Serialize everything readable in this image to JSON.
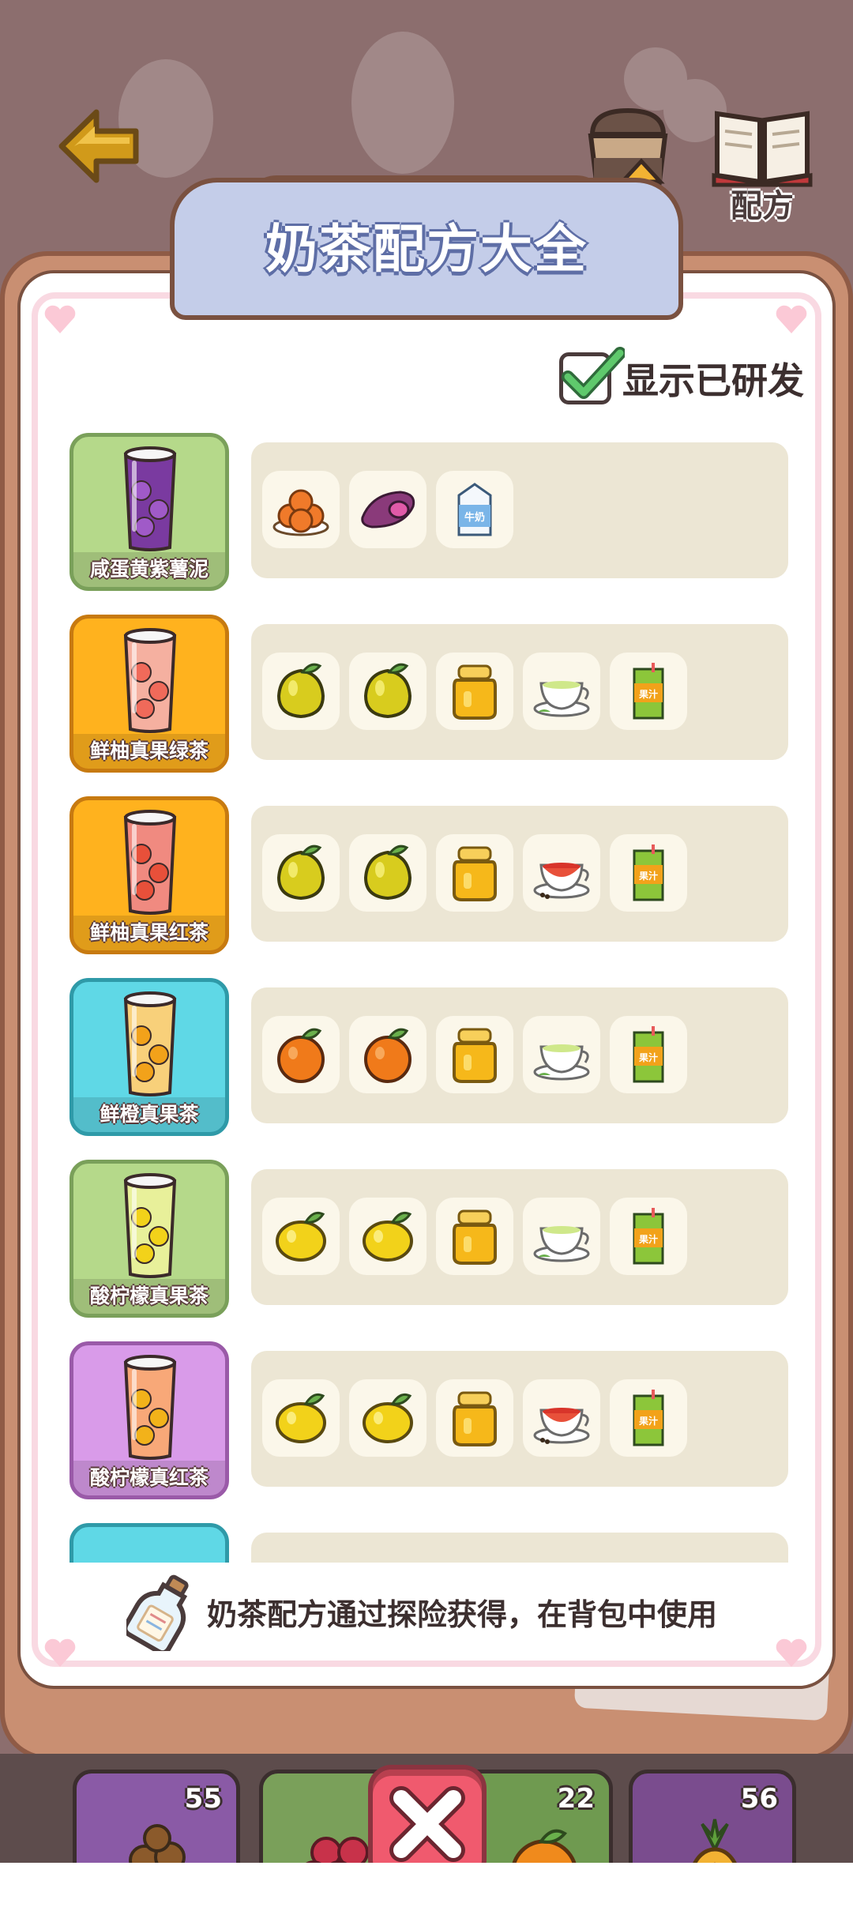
{
  "header": {
    "back_icon": "back-arrow-icon",
    "upgrade_icon": "cup-upgrade-icon",
    "recipe_icon": "open-book-icon",
    "recipe_label": "配方"
  },
  "panel": {
    "title": "奶茶配方大全",
    "show_researched_label": "显示已研发",
    "show_researched_checked": true,
    "hint": "奶茶配方通过探险获得，在背包中使用"
  },
  "recipes": [
    {
      "name": "咸蛋黄紫薯泥",
      "card_color": "#b5d98a",
      "ingredients": [
        "salted-egg-yolk-icon",
        "purple-sweet-potato-icon",
        "milk-carton-icon"
      ]
    },
    {
      "name": "鲜柚真果绿茶",
      "card_color": "#ffb21e",
      "ingredients": [
        "pomelo-icon",
        "pomelo-icon",
        "honey-jar-icon",
        "green-tea-icon",
        "juice-box-icon"
      ]
    },
    {
      "name": "鲜柚真果红茶",
      "card_color": "#ffb21e",
      "ingredients": [
        "pomelo-icon",
        "pomelo-icon",
        "honey-jar-icon",
        "black-tea-icon",
        "juice-box-icon"
      ]
    },
    {
      "name": "鲜橙真果茶",
      "card_color": "#5fd8e6",
      "ingredients": [
        "orange-icon",
        "orange-icon",
        "honey-jar-icon",
        "green-tea-icon",
        "juice-box-icon"
      ]
    },
    {
      "name": "酸柠檬真果茶",
      "card_color": "#b5d98a",
      "ingredients": [
        "lemon-icon",
        "lemon-icon",
        "honey-jar-icon",
        "green-tea-icon",
        "juice-box-icon"
      ]
    },
    {
      "name": "酸柠檬真红茶",
      "card_color": "#d99be9",
      "ingredients": [
        "lemon-icon",
        "lemon-icon",
        "honey-jar-icon",
        "black-tea-icon",
        "juice-box-icon"
      ]
    }
  ],
  "inventory": [
    {
      "icon": "tapioca-pearls-icon",
      "count": "55"
    },
    {
      "icon": "grapes-icon",
      "count": ""
    },
    {
      "icon": "orange-icon",
      "count": "22"
    },
    {
      "icon": "pineapple-icon",
      "count": "56"
    }
  ],
  "close_icon": "close-x-icon",
  "juice_box_label": "果汁",
  "milk_carton_label": "牛奶"
}
